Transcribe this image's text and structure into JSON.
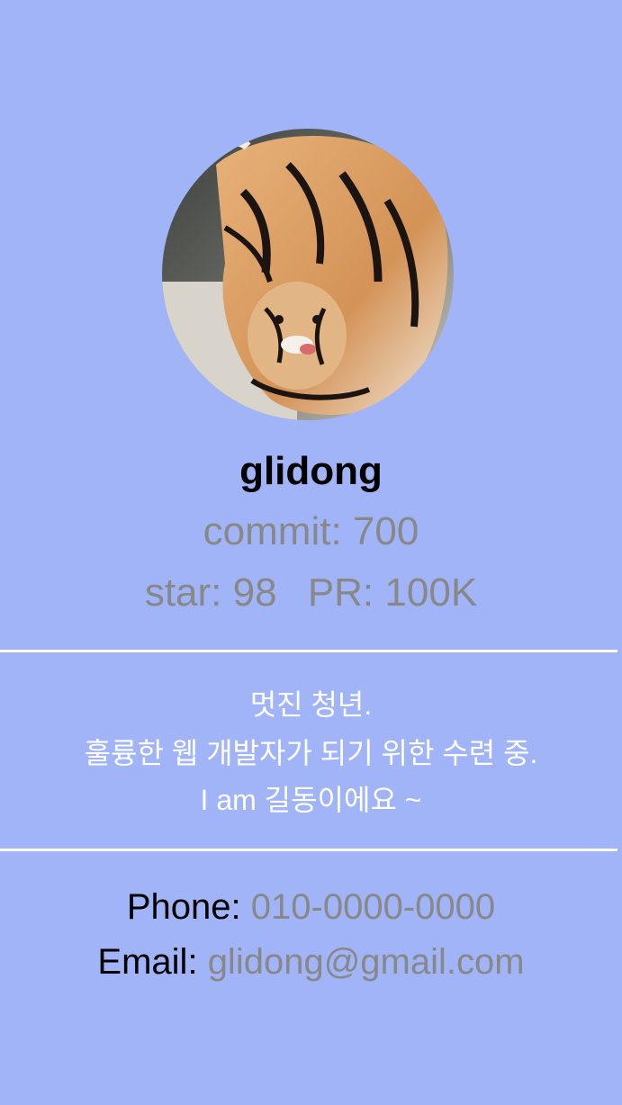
{
  "profile": {
    "avatar_description_icon": "tiger-photo",
    "username": "glidong",
    "stats": {
      "commit_label": "commit:",
      "commit_value": "700",
      "star_label": "star:",
      "star_value": "98",
      "pr_label": "PR:",
      "pr_value": "100K"
    }
  },
  "bio": {
    "line1": "멋진 청년.",
    "line2": "훌륭한 웹 개발자가 되기 위한 수련 중.",
    "line3": "I am 길동이에요 ~"
  },
  "contact": {
    "phone_label": "Phone:",
    "phone_value": "010-0000-0000",
    "email_label": "Email:",
    "email_value": "glidong@gmail.com"
  },
  "colors": {
    "background": "#a0b4f7",
    "divider": "#ffffff",
    "muted_text": "#888888"
  }
}
